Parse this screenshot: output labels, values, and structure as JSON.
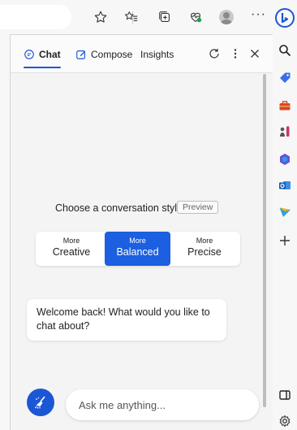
{
  "toolbar": {
    "icons": [
      "star-icon",
      "favorites-icon",
      "collections-icon",
      "browser-essentials-icon",
      "profile-avatar",
      "more-icon"
    ],
    "more_label": "···"
  },
  "panel": {
    "tabs": [
      {
        "label": "Chat",
        "icon": "chat-icon",
        "active": true
      },
      {
        "label": "Compose",
        "icon": "compose-icon",
        "active": false
      },
      {
        "label": "Insights",
        "active": false
      }
    ],
    "header_actions": [
      "refresh-icon",
      "more-vertical-icon",
      "close-icon"
    ]
  },
  "conversation_style": {
    "label": "Choose a conversation style",
    "badge": "Preview",
    "options": [
      {
        "small": "More",
        "big": "Creative",
        "selected": false
      },
      {
        "small": "More",
        "big": "Balanced",
        "selected": true
      },
      {
        "small": "More",
        "big": "Precise",
        "selected": false
      }
    ]
  },
  "messages": [
    {
      "text": "Welcome back! What would you like to chat about?"
    }
  ],
  "input": {
    "placeholder": "Ask me anything..."
  },
  "sidebar": {
    "items": [
      "bing-icon",
      "search-icon",
      "shopping-tag-icon",
      "tools-icon",
      "games-icon",
      "office-icon",
      "outlook-icon",
      "drop-icon",
      "add-icon",
      "sidebar-toggle-icon",
      "settings-icon"
    ]
  },
  "colors": {
    "accent": "#1b56d4",
    "selected_style": "#1c5fe0",
    "panel_bg": "#f4f4f4"
  }
}
